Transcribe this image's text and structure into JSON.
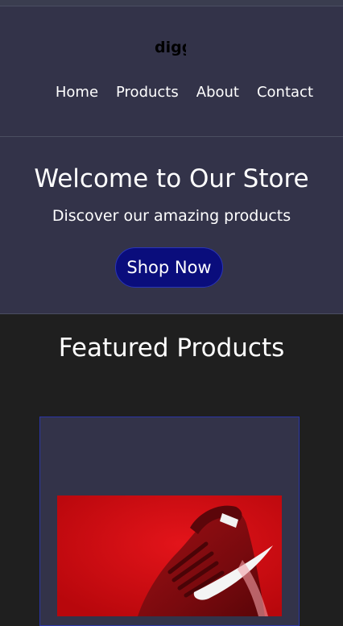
{
  "header": {
    "logo_text": "digg",
    "nav": [
      {
        "label": "Home"
      },
      {
        "label": "Products"
      },
      {
        "label": "About"
      },
      {
        "label": "Contact"
      }
    ]
  },
  "hero": {
    "title": "Welcome to Our Store",
    "subtitle": "Discover our amazing products",
    "cta_label": "Shop Now"
  },
  "featured": {
    "title": "Featured Products",
    "products": [
      {
        "image_icon": "red-sneaker-image"
      }
    ]
  },
  "colors": {
    "header_bg": "#333349",
    "page_bg": "#1f1f1f",
    "cta_bg": "#0a0d7c",
    "card_border": "#2a35a8",
    "product_image_bg": "#d20c12"
  }
}
